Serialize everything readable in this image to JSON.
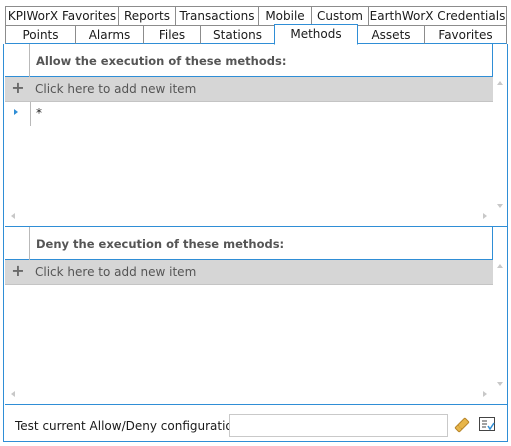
{
  "tabs": {
    "row1": [
      {
        "label": "KPIWorX Favorites"
      },
      {
        "label": "Reports"
      },
      {
        "label": "Transactions"
      },
      {
        "label": "Mobile"
      },
      {
        "label": "Custom"
      },
      {
        "label": "EarthWorX Credentials"
      }
    ],
    "row2": [
      {
        "label": "Points"
      },
      {
        "label": "Alarms"
      },
      {
        "label": "Files"
      },
      {
        "label": "Stations"
      },
      {
        "label": "Methods",
        "selected": true
      },
      {
        "label": "Assets"
      },
      {
        "label": "Favorites"
      }
    ]
  },
  "allow_grid": {
    "header": "Allow the execution of these methods:",
    "add_item_label": "Click here to add new item",
    "rows": [
      {
        "value": "*"
      }
    ]
  },
  "deny_grid": {
    "header": "Deny the execution of these methods:",
    "add_item_label": "Click here to add new item",
    "rows": []
  },
  "test_bar": {
    "label": "Test current Allow/Deny configuration:",
    "input_value": "",
    "input_placeholder": ""
  },
  "colors": {
    "accent": "#2f8ed6",
    "add_row_bg": "#d6d6d6",
    "tab_border": "#8c8c8c"
  }
}
